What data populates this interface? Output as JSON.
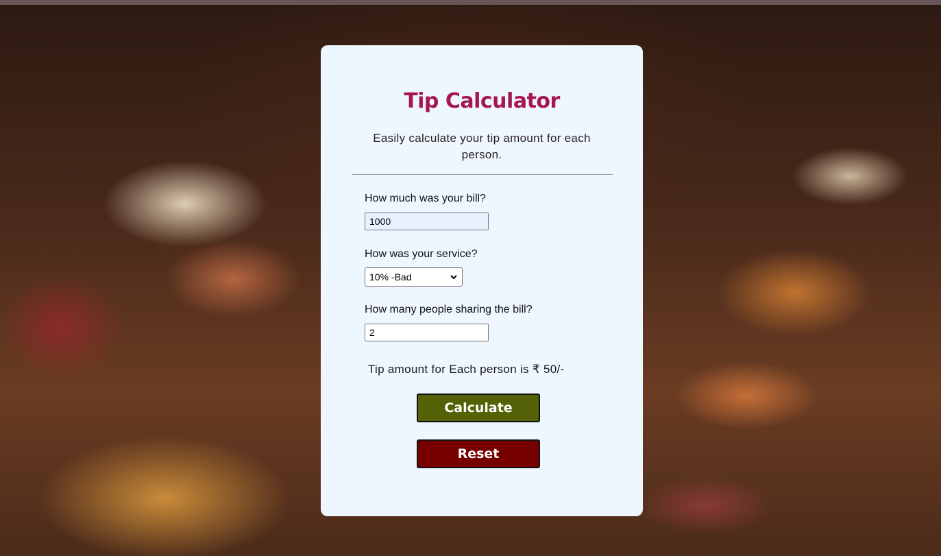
{
  "card": {
    "title": "Tip Calculator",
    "subtitle": "Easily calculate your tip amount for each person."
  },
  "bill": {
    "label": "How much was your bill?",
    "value": "1000"
  },
  "service": {
    "label": "How was your service?",
    "selected": "10% -Bad"
  },
  "people": {
    "label": "How many people sharing the bill?",
    "value": "2"
  },
  "result": {
    "text": "Tip amount for Each person is ₹ 50/-"
  },
  "buttons": {
    "calculate": "Calculate",
    "reset": "Reset"
  },
  "colors": {
    "title": "#a6154d",
    "card": "#eef6ff",
    "calculate": "#556107",
    "reset": "#760000"
  }
}
